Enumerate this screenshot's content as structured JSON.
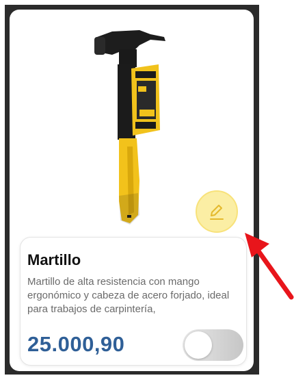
{
  "product": {
    "name": "Martillo",
    "description": "Martillo de alta resistencia con mango ergonómico y cabeza de acero forjado, ideal para trabajos de carpintería,",
    "price": "25.000,90",
    "image_icon": "hammer-image",
    "available_toggle": {
      "state": "off"
    }
  },
  "actions": {
    "edit_icon": "pencil-icon"
  },
  "annotation": {
    "arrow_icon": "red-arrow",
    "color": "#e8151b"
  },
  "colors": {
    "price": "#2f5f97",
    "edit_button_bg": "#fbeea4",
    "hammer_handle": "#f2c21b"
  }
}
